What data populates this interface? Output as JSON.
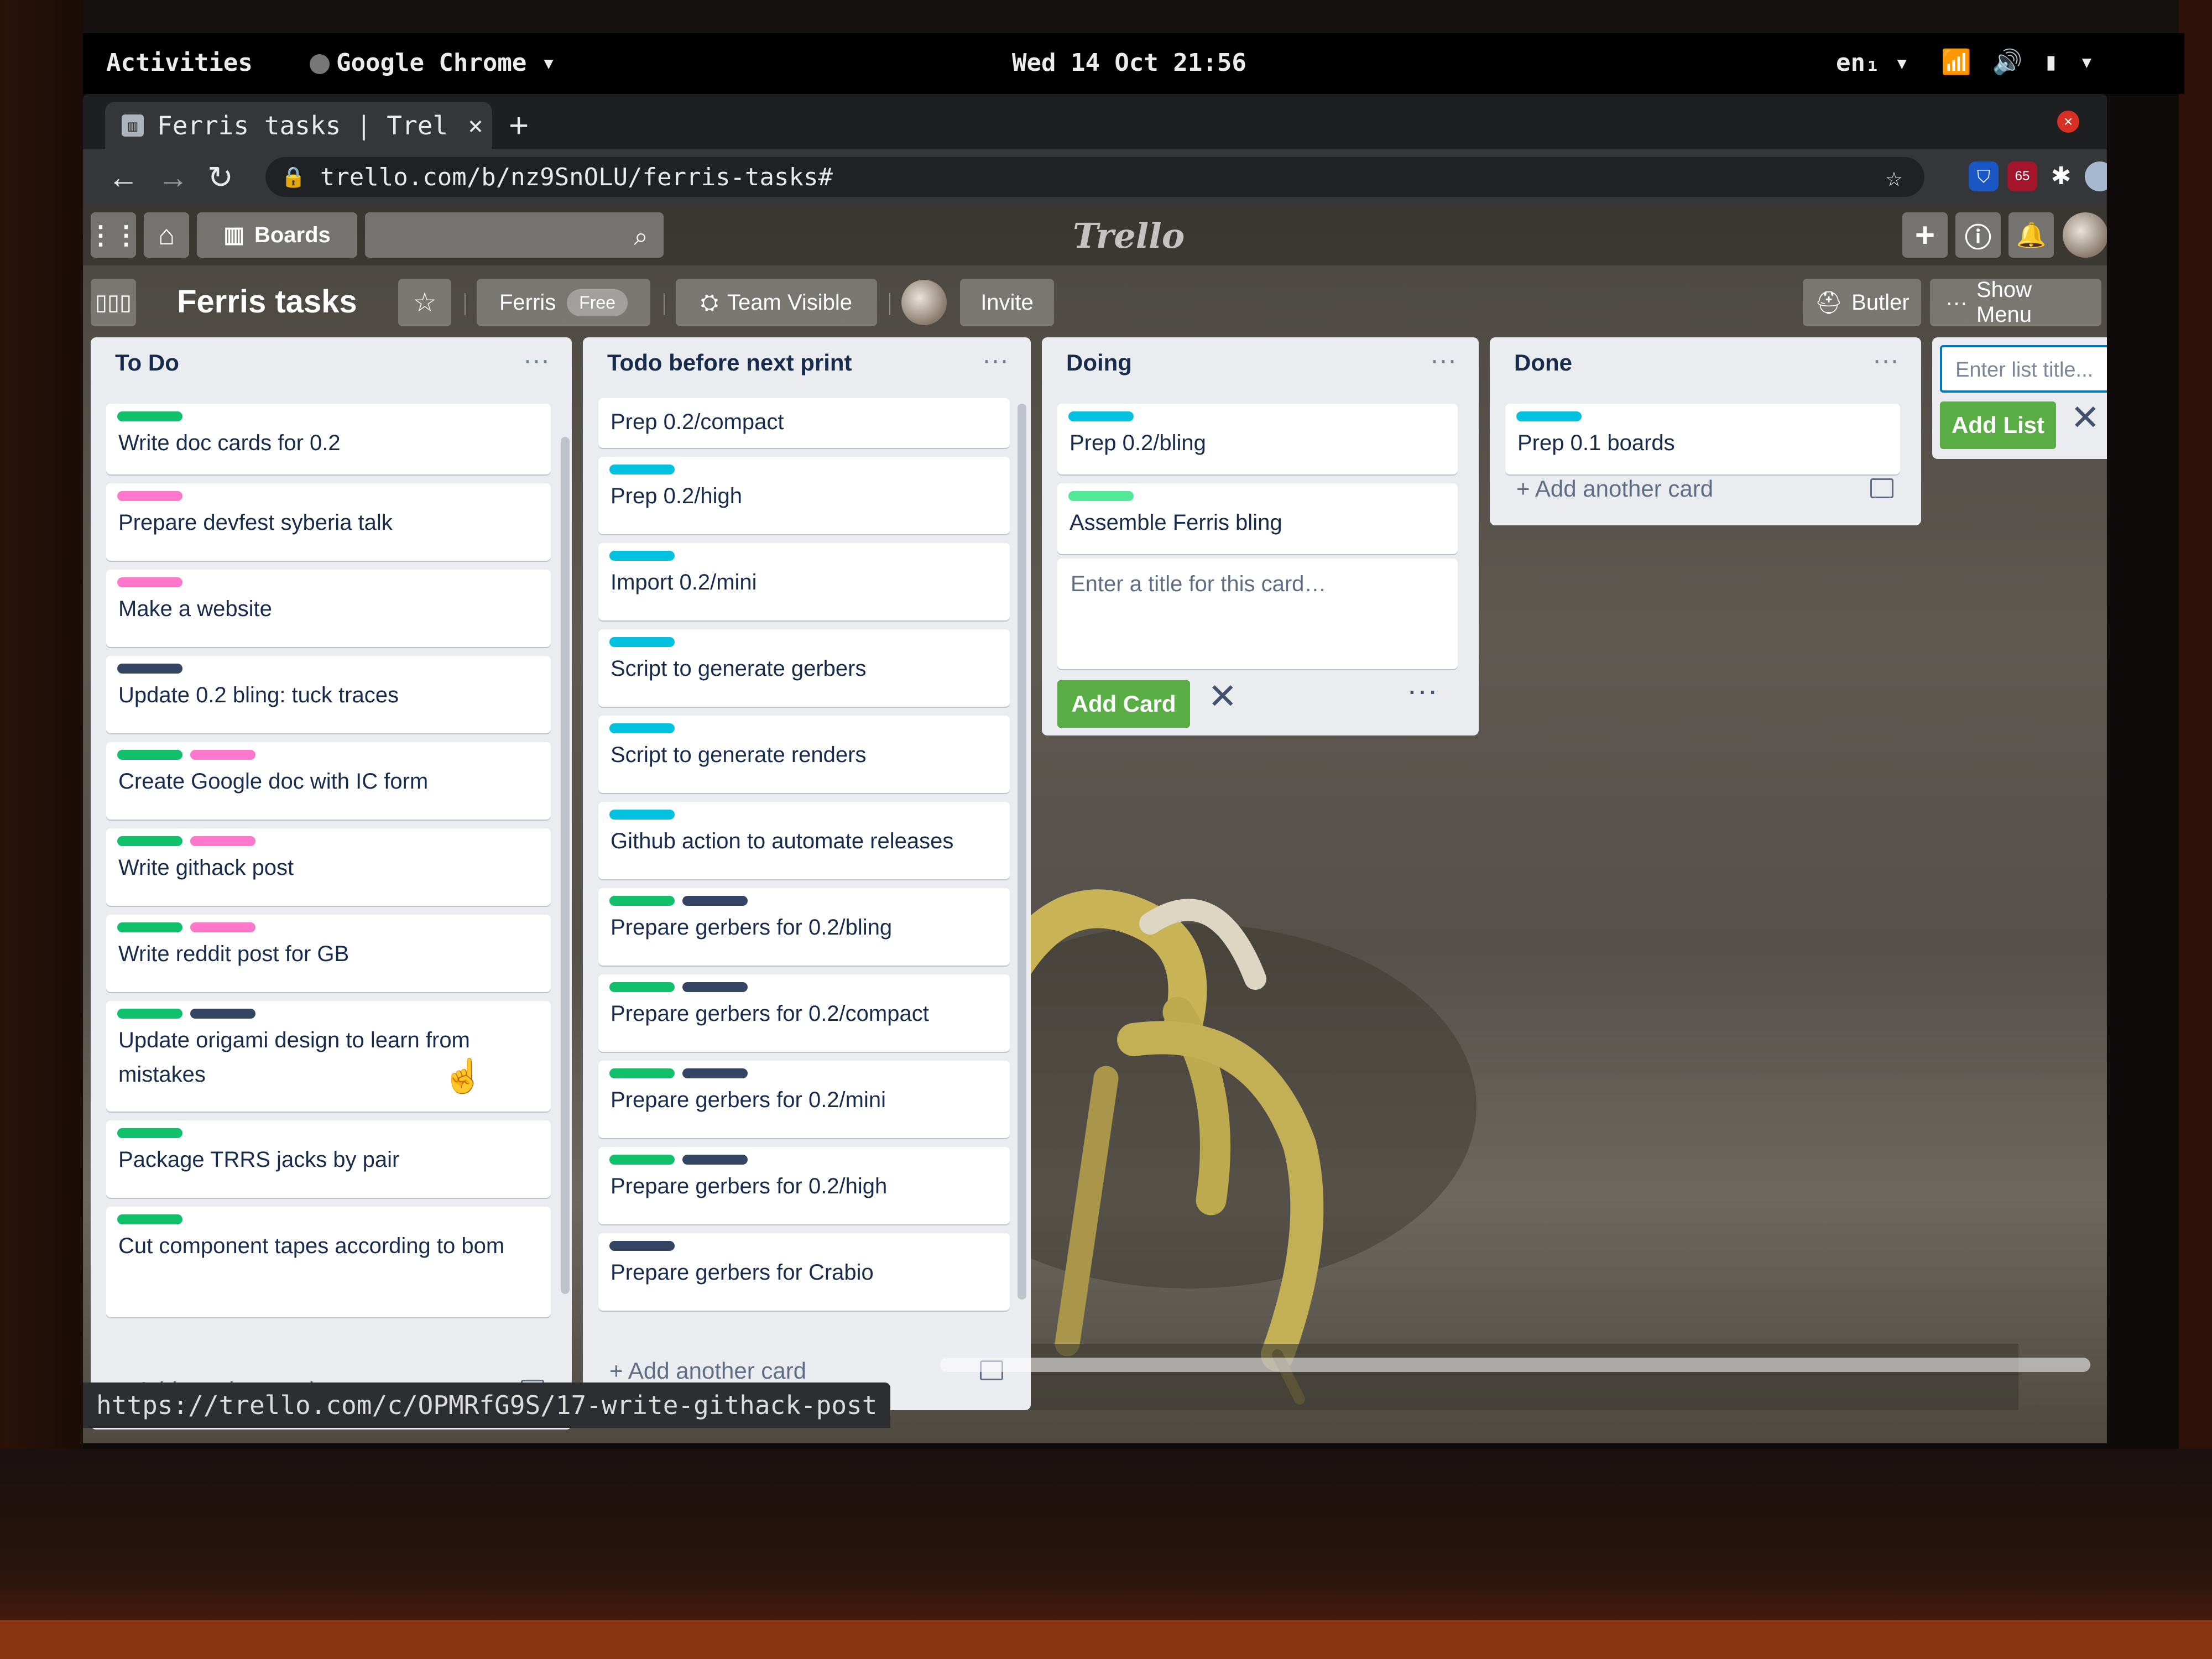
{
  "gnome": {
    "activities": "Activities",
    "app_name": "Google Chrome ▾",
    "clock": "Wed 14 Oct 21:56",
    "lang": "en₁ ▾",
    "tray_icons": [
      "wifi-icon",
      "volume-icon",
      "battery-icon",
      "caret-down-icon"
    ]
  },
  "browser": {
    "tab_title": "Ferris tasks | Trel",
    "tab_close": "×",
    "new_tab": "+",
    "url": "trello.com/b/nz9SnOLU/ferris-tasks#",
    "extension_badge": "65",
    "status_url": "https://trello.com/c/OPMRfG9S/17-write-githack-post"
  },
  "header": {
    "boards_label": "Boards",
    "logo": "Trello",
    "colors": {
      "bg": "#1e1f21",
      "accent_green": "#5aac44"
    }
  },
  "board": {
    "title": "Ferris tasks",
    "team": "Ferris",
    "team_badge": "Free",
    "visibility": "Team Visible",
    "invite": "Invite",
    "butler": "Butler",
    "show_menu": "Show Menu"
  },
  "lists": {
    "todo": {
      "title": "To Do",
      "menu": "···",
      "add_card": "+ Add another card",
      "cards": [
        {
          "text": "Write doc cards for 0.2",
          "labels": [
            "green2"
          ]
        },
        {
          "text": "Prepare devfest syberia talk",
          "labels": [
            "pink"
          ]
        },
        {
          "text": "Make a website",
          "labels": [
            "pink"
          ]
        },
        {
          "text": "Update 0.2 bling: tuck traces",
          "labels": [
            "black"
          ]
        },
        {
          "text": "Create Google doc with IC form",
          "labels": [
            "green2",
            "pink"
          ]
        },
        {
          "text": "Write githack post",
          "labels": [
            "green2",
            "pink"
          ]
        },
        {
          "text": "Write reddit post for GB",
          "labels": [
            "green2",
            "pink"
          ]
        },
        {
          "text": "Update origami design to learn from mistakes",
          "labels": [
            "green2",
            "black"
          ]
        },
        {
          "text": "Package TRRS jacks by pair",
          "labels": [
            "green2"
          ]
        },
        {
          "text": "Cut component tapes according to bom",
          "labels": [
            "green2"
          ]
        }
      ]
    },
    "next_print": {
      "title": "Todo before next print",
      "menu": "···",
      "add_card": "+ Add another card",
      "cards": [
        {
          "text": "Prep 0.2/compact",
          "labels": []
        },
        {
          "text": "Prep 0.2/high",
          "labels": [
            "sky"
          ]
        },
        {
          "text": "Import 0.2/mini",
          "labels": [
            "sky"
          ]
        },
        {
          "text": "Script to generate gerbers",
          "labels": [
            "sky"
          ]
        },
        {
          "text": "Script to generate renders",
          "labels": [
            "sky"
          ]
        },
        {
          "text": "Github action to automate releases",
          "labels": [
            "sky"
          ]
        },
        {
          "text": "Prepare gerbers for 0.2/bling",
          "labels": [
            "green2",
            "black"
          ]
        },
        {
          "text": "Prepare gerbers for 0.2/compact",
          "labels": [
            "green2",
            "black"
          ]
        },
        {
          "text": "Prepare gerbers for 0.2/mini",
          "labels": [
            "green2",
            "black"
          ]
        },
        {
          "text": "Prepare gerbers for 0.2/high",
          "labels": [
            "green2",
            "black"
          ]
        },
        {
          "text": "Prepare gerbers for Crabio",
          "labels": [
            "black"
          ]
        }
      ]
    },
    "doing": {
      "title": "Doing",
      "menu": "···",
      "cards": [
        {
          "text": "Prep 0.2/bling",
          "labels": [
            "sky"
          ]
        },
        {
          "text": "Assemble Ferris bling",
          "labels": [
            "lime"
          ]
        }
      ],
      "composer_placeholder": "Enter a title for this card…",
      "add_button": "Add Card",
      "close": "✕",
      "more": "···"
    },
    "done": {
      "title": "Done",
      "menu": "···",
      "add_card": "+ Add another card",
      "cards": [
        {
          "text": "Prep 0.1 boards",
          "labels": [
            "sky"
          ]
        }
      ]
    },
    "new_list": {
      "placeholder": "Enter list title...",
      "add_button": "Add List",
      "close": "✕"
    }
  }
}
